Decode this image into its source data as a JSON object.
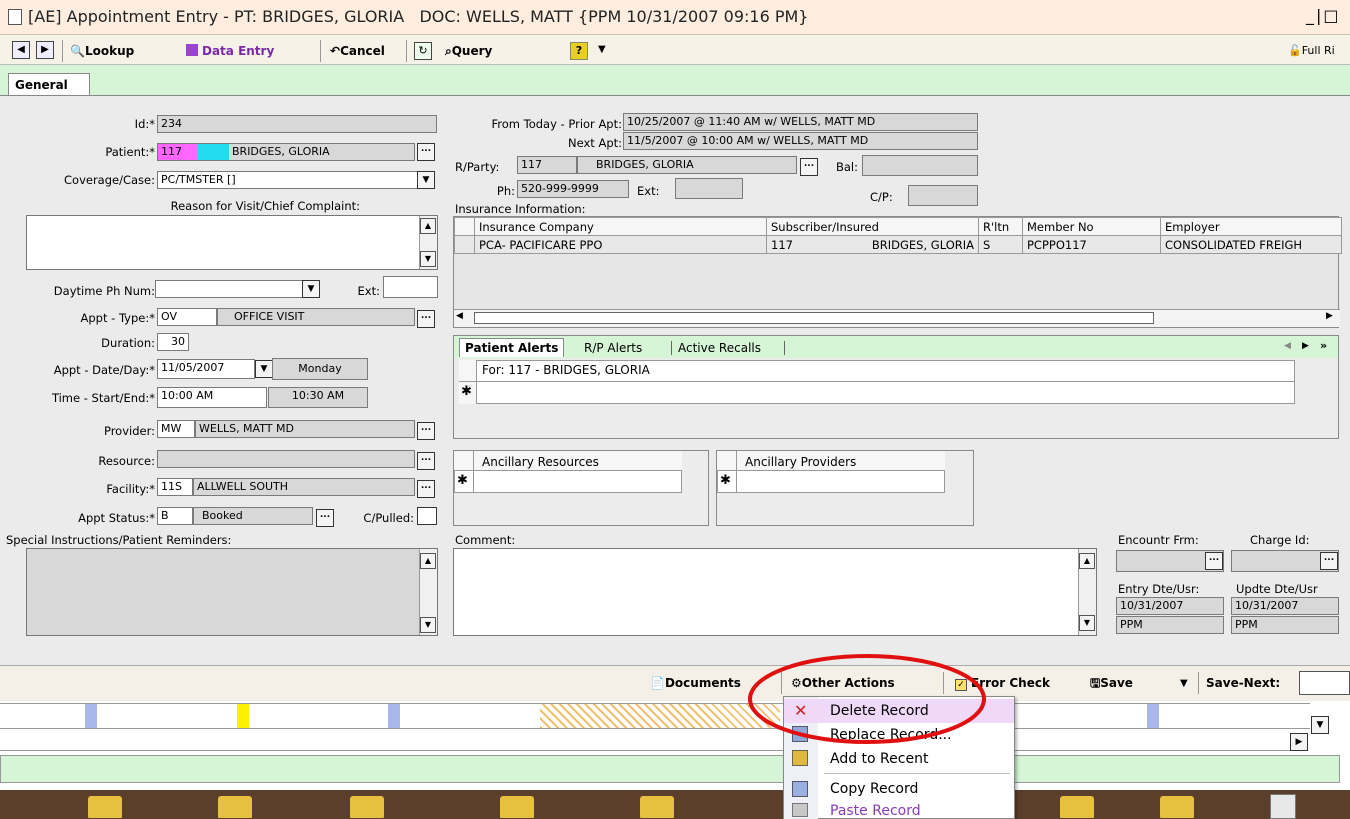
{
  "window": {
    "title": "[AE] Appointment Entry - PT: BRIDGES, GLORIA   DOC: WELLS, MATT {PPM 10/31/2007 09:16 PM}",
    "controls": "_|□"
  },
  "toolbar": {
    "lookup": "Lookup",
    "data_entry": "Data Entry",
    "cancel": "Cancel",
    "query": "Query",
    "full_rights": "Full Ri"
  },
  "tabs": {
    "general": "General"
  },
  "form": {
    "id_label": "Id:*",
    "id_value": "234",
    "patient_label": "Patient:*",
    "patient_code": "117",
    "patient_name": "BRIDGES, GLORIA",
    "coverage_label": "Coverage/Case:",
    "coverage_value": "PC/TMSTER []",
    "reason_label": "Reason for Visit/Chief Complaint:",
    "daytime_label": "Daytime Ph Num:",
    "ext_label": "Ext:",
    "appt_type_label": "Appt - Type:*",
    "appt_type_code": "OV",
    "appt_type_name": "OFFICE VISIT",
    "duration_label": "Duration:",
    "duration_value": "30",
    "appt_date_label": "Appt - Date/Day:*",
    "appt_date": "11/05/2007",
    "appt_day": "Monday",
    "time_label": "Time - Start/End:*",
    "time_start": "10:00 AM",
    "time_end": "10:30 AM",
    "provider_label": "Provider:",
    "provider_code": "MW",
    "provider_name": "WELLS, MATT MD",
    "resource_label": "Resource:",
    "facility_label": "Facility:*",
    "facility_code": "11S",
    "facility_name": "ALLWELL SOUTH",
    "appt_status_label": "Appt Status:*",
    "appt_status_code": "B",
    "appt_status_name": "Booked",
    "cpulled_label": "C/Pulled:",
    "special_label": "Special Instructions/Patient Reminders:",
    "prior_apt_label": "From Today - Prior Apt:",
    "prior_apt_value": "10/25/2007 @ 11:40 AM w/ WELLS, MATT MD",
    "next_apt_label": "Next Apt:",
    "next_apt_value": "11/5/2007 @ 10:00 AM w/ WELLS, MATT MD",
    "rparty_label": "R/Party:",
    "rparty_code": "117",
    "rparty_name": "BRIDGES, GLORIA",
    "bal_label": "Bal:",
    "ph_label": "Ph:",
    "ph_value": "520-999-9999",
    "ph_ext_label": "Ext:",
    "cp_label": "C/P:",
    "insurance_label": "Insurance Information:",
    "insurance_headers": [
      "Insurance Company",
      "Subscriber/Insured",
      "R'ltn",
      "Member No",
      "Employer"
    ],
    "insurance_row": [
      "PCA- PACIFICARE PPO",
      "117",
      "BRIDGES, GLORIA",
      "S",
      "PCPPO117",
      "CONSOLIDATED FREIGH"
    ],
    "alerts_tabs": [
      "Patient Alerts",
      "R/P Alerts",
      "Active Recalls"
    ],
    "alerts_for": "For: 117 - BRIDGES, GLORIA",
    "ancillary_resources": "Ancillary Resources",
    "ancillary_providers": "Ancillary Providers",
    "comment_label": "Comment:",
    "encountr_label": "Encountr Frm:",
    "charge_label": "Charge Id:",
    "entry_label": "Entry Dte/Usr:",
    "update_label": "Updte Dte/Usr",
    "entry_date": "10/31/2007",
    "entry_user": "PPM",
    "update_date": "10/31/2007",
    "update_user": "PPM",
    "new_row_marker": "✱"
  },
  "bottom_toolbar": {
    "documents": "Documents",
    "other_actions": "Other Actions",
    "error_check": "Error Check",
    "save": "Save",
    "save_next": "Save-Next:"
  },
  "context_menu": {
    "items": [
      "Delete Record",
      "Replace Record...",
      "Add to Recent",
      "Copy Record",
      "Paste Record"
    ]
  },
  "colors": {
    "highlight_circle": "#e01010",
    "patient_code_bg": "#ff66ff",
    "patient_name_bg": "#22ddee",
    "menu_hover": "#f0d8f8"
  }
}
